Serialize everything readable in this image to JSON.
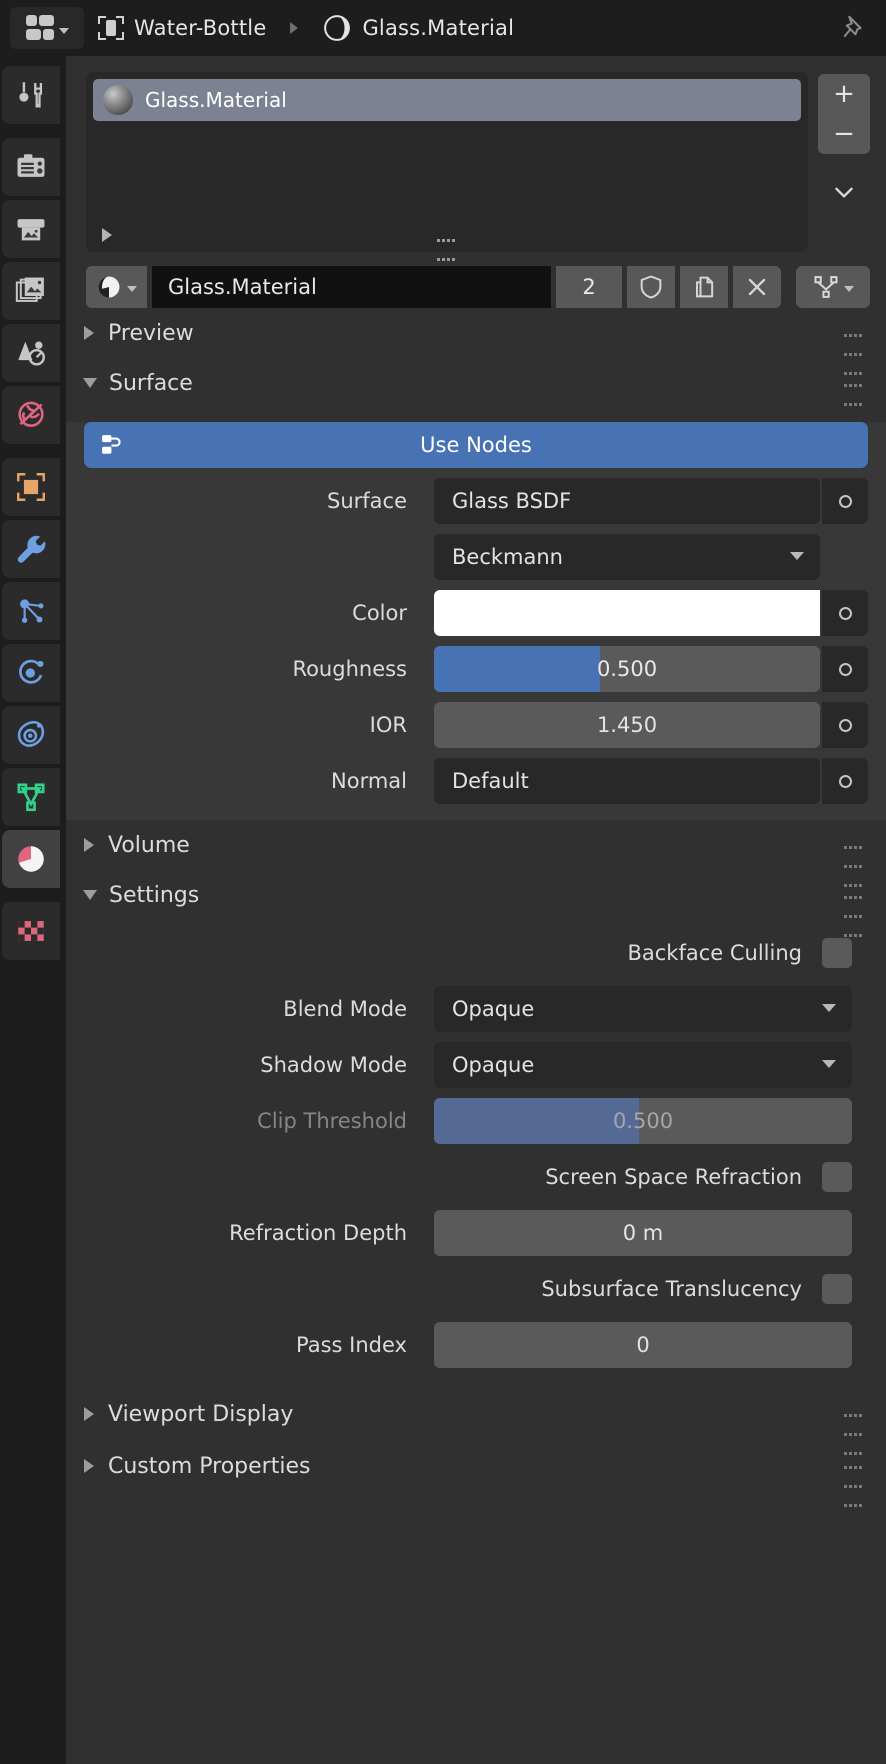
{
  "header": {
    "editor_type_icon": "properties-editor-icon",
    "object_icon": "object-data-icon",
    "object_name": "Water-Bottle",
    "material_icon": "material-sphere-icon",
    "material_name": "Glass.Material",
    "pin_icon": "pin-icon"
  },
  "rail": {
    "items": [
      {
        "name": "tool",
        "icon": "tool-icon",
        "color": "#c6c6c6",
        "active": false
      },
      {
        "name": "render",
        "icon": "camera-back-icon",
        "color": "#c6c6c6",
        "active": false
      },
      {
        "name": "output",
        "icon": "printer-icon",
        "color": "#c6c6c6",
        "active": false
      },
      {
        "name": "view-layer",
        "icon": "images-icon",
        "color": "#c6c6c6",
        "active": false
      },
      {
        "name": "scene",
        "icon": "cone-sphere-icon",
        "color": "#c6c6c6",
        "active": false
      },
      {
        "name": "world",
        "icon": "world-globe-icon",
        "color": "#e0657f",
        "active": false
      },
      {
        "name": "object",
        "icon": "object-square-icon",
        "color": "#e4a567",
        "active": false
      },
      {
        "name": "modifiers",
        "icon": "wrench-icon",
        "color": "#6e9fe0",
        "active": false
      },
      {
        "name": "particles",
        "icon": "particles-icon",
        "color": "#6e9fe0",
        "active": false
      },
      {
        "name": "physics",
        "icon": "physics-orbit-icon",
        "color": "#6e9fe0",
        "active": false
      },
      {
        "name": "constraints",
        "icon": "constraint-icon",
        "color": "#6e9fe0",
        "active": false
      },
      {
        "name": "object-data",
        "icon": "mesh-data-triangle-icon",
        "color": "#2fd18b",
        "active": false
      },
      {
        "name": "material",
        "icon": "material-sphere-icon",
        "color": "#e0657f",
        "active": true
      },
      {
        "name": "texture",
        "icon": "checker-texture-icon",
        "color": "#e0657f",
        "active": false
      }
    ]
  },
  "slot_list": {
    "slots": [
      {
        "name": "Glass.Material",
        "selected": true
      }
    ],
    "add_label": "+",
    "remove_label": "−",
    "specials_icon": "chevron-down-icon",
    "expand_icon": "triangle-right-icon",
    "grip_icon": "grip-dots-icon"
  },
  "id_row": {
    "browse_icon": "material-sphere-icon",
    "browse_chevron": "chevron-down-icon",
    "name_value": "Glass.Material",
    "name_placeholder": "Name",
    "users_count": "2",
    "fake_user_icon": "shield-icon",
    "new_material_icon": "copy-icon",
    "unlink_icon": "x-icon",
    "node_tree_icon": "node-tree-icon",
    "node_tree_chevron": "chevron-down-icon"
  },
  "panels": {
    "preview": {
      "label": "Preview",
      "expanded": false
    },
    "surface": {
      "label": "Surface",
      "expanded": true
    },
    "volume": {
      "label": "Volume",
      "expanded": false
    },
    "settings": {
      "label": "Settings",
      "expanded": true
    },
    "viewport_display": {
      "label": "Viewport Display",
      "expanded": false
    },
    "custom_properties": {
      "label": "Custom Properties",
      "expanded": false
    }
  },
  "surface": {
    "use_nodes_label": "Use Nodes",
    "use_nodes_color": "#4772b3",
    "use_nodes_icon": "nodetree-icon",
    "surface_label": "Surface",
    "surface_value": "Glass BSDF",
    "distribution_value": "Beckmann",
    "color_label": "Color",
    "color_value": "#ffffff",
    "roughness_label": "Roughness",
    "roughness_value": "0.500",
    "roughness_fill_percent": 43,
    "ior_label": "IOR",
    "ior_value": "1.450",
    "normal_label": "Normal",
    "normal_value": "Default"
  },
  "settings": {
    "backface_culling_label": "Backface Culling",
    "backface_culling_checked": false,
    "blend_mode_label": "Blend Mode",
    "blend_mode_value": "Opaque",
    "shadow_mode_label": "Shadow Mode",
    "shadow_mode_value": "Opaque",
    "clip_threshold_label": "Clip Threshold",
    "clip_threshold_value": "0.500",
    "clip_threshold_fill_percent": 49,
    "clip_threshold_enabled": false,
    "ssr_label": "Screen Space Refraction",
    "ssr_checked": false,
    "refraction_depth_label": "Refraction Depth",
    "refraction_depth_value": "0 m",
    "subsurface_translucency_label": "Subsurface Translucency",
    "subsurface_translucency_checked": false,
    "pass_index_label": "Pass Index",
    "pass_index_value": "0"
  }
}
